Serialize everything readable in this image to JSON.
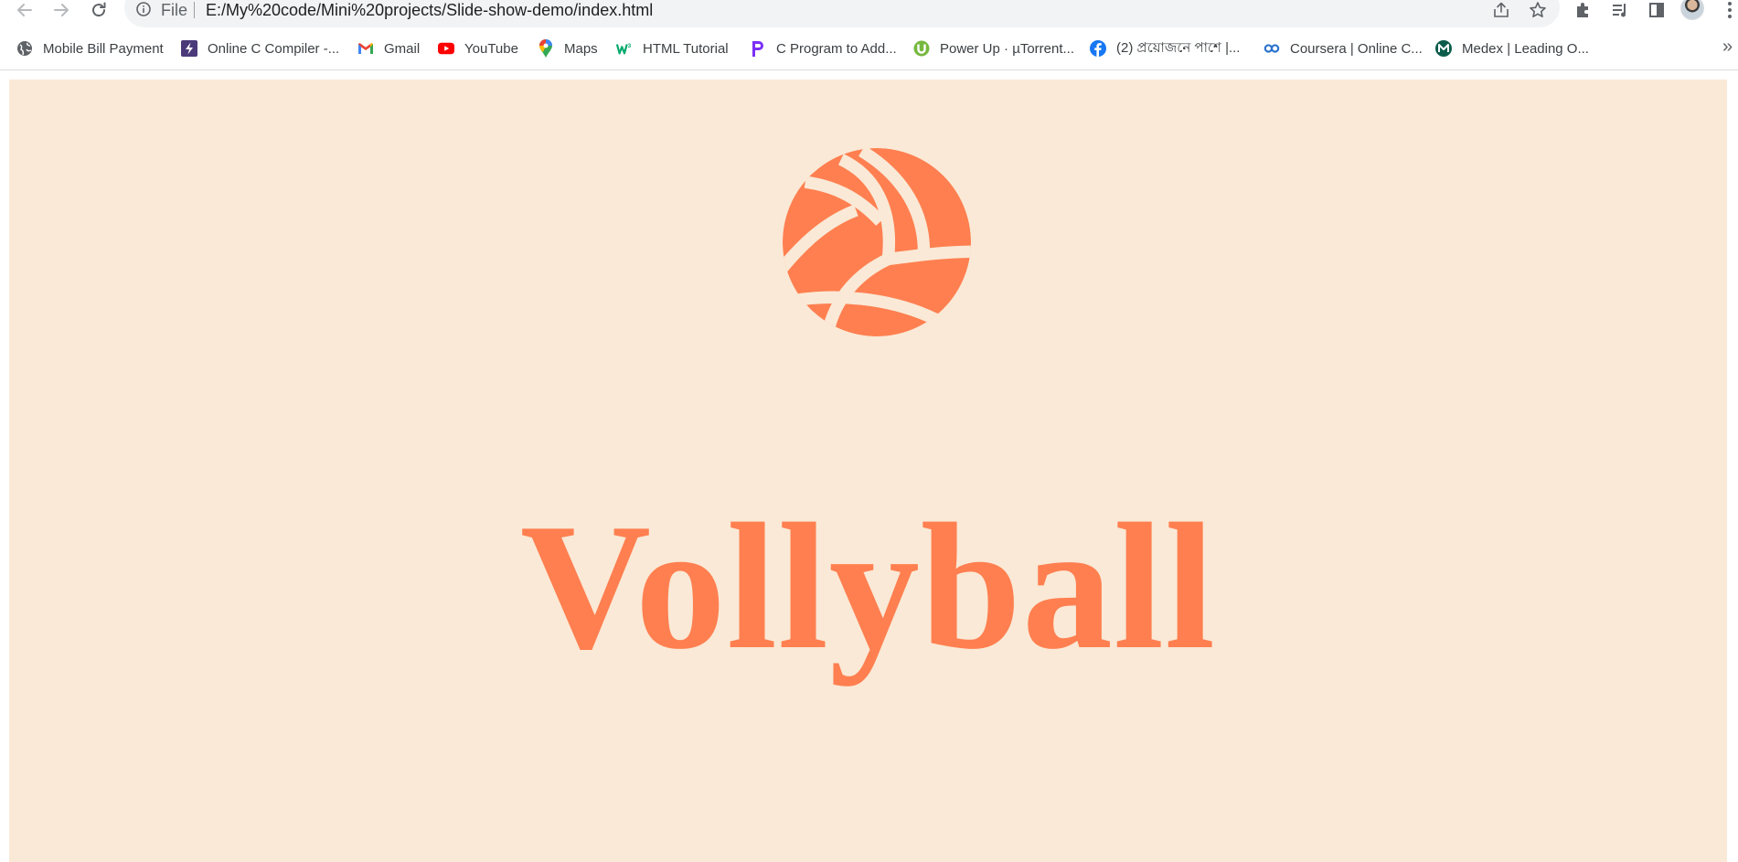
{
  "browser": {
    "omnibox": {
      "scheme_label": "File",
      "url": "E:/My%20code/Mini%20projects/Slide-show-demo/index.html"
    },
    "toolbar_icons": [
      "back-icon",
      "forward-icon",
      "reload-icon",
      "info-icon",
      "share-icon",
      "star-icon",
      "extensions-icon",
      "media-icon",
      "side-panel-icon",
      "profile-avatar",
      "menu-icon"
    ],
    "bookmarks": [
      {
        "label": "Mobile Bill Payment",
        "icon": "globe-icon"
      },
      {
        "label": "Online C Compiler -...",
        "icon": "lightning-icon"
      },
      {
        "label": "Gmail",
        "icon": "gmail-icon"
      },
      {
        "label": "YouTube",
        "icon": "youtube-icon"
      },
      {
        "label": "Maps",
        "icon": "maps-pin-icon"
      },
      {
        "label": "HTML Tutorial",
        "icon": "w3schools-icon"
      },
      {
        "label": "C Program to Add...",
        "icon": "p-logo-icon"
      },
      {
        "label": "Power Up · µTorrent...",
        "icon": "utorrent-icon"
      },
      {
        "label": "(2) প্রয়োজনে পাশে |...",
        "icon": "facebook-icon"
      },
      {
        "label": "Coursera | Online C...",
        "icon": "coursera-icon"
      },
      {
        "label": "Medex | Leading O...",
        "icon": "medex-icon"
      }
    ],
    "bookmarks_overflow": "»"
  },
  "slide": {
    "title": "Vollyball",
    "image": "volleyball-icon"
  },
  "colors": {
    "slide_background": "#fae9d6",
    "accent": "#ff7f50",
    "omnibox_background": "#f1f3f4"
  }
}
